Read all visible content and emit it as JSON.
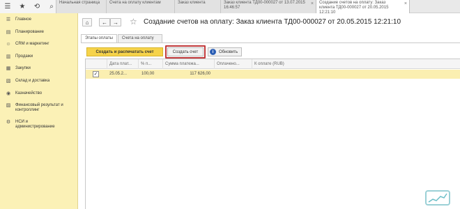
{
  "topbar": {
    "icons": [
      "menu-icon",
      "star-icon",
      "history-icon",
      "search-icon"
    ],
    "tabs": [
      {
        "label": "Начальная страница",
        "active": false
      },
      {
        "label": "Счета на оплату клиентам",
        "active": false
      },
      {
        "label": "Заказ клиента",
        "active": false
      },
      {
        "label": "Заказ клиента ТД00-000027 от 13.07.2015 16:46:57",
        "active": false
      },
      {
        "label": "Создание счетов на оплату: Заказ клиента ТД00-000027 от 20.05.2015 12:21:10",
        "active": true
      }
    ]
  },
  "sidebar": {
    "items": [
      {
        "label": "Главное",
        "icon": "list-icon"
      },
      {
        "label": "Планирование",
        "icon": "planning-icon"
      },
      {
        "label": "CRM и маркетинг",
        "icon": "crm-icon"
      },
      {
        "label": "Продажи",
        "icon": "sales-icon"
      },
      {
        "label": "Закупки",
        "icon": "purchases-icon"
      },
      {
        "label": "Склад и доставка",
        "icon": "warehouse-icon"
      },
      {
        "label": "Казначейство",
        "icon": "treasury-icon"
      },
      {
        "label": "Финансовый результат и контроллинг",
        "icon": "finance-icon"
      },
      {
        "label": "НСИ и администрирование",
        "icon": "settings-icon"
      }
    ]
  },
  "header": {
    "title": "Создание счетов на оплату: Заказ клиента ТД00-000027 от 20.05.2015 12:21:10"
  },
  "form_tabs": [
    {
      "label": "Этапы оплаты",
      "active": true
    },
    {
      "label": "Счета на оплату",
      "active": false
    }
  ],
  "toolbar": {
    "create_and_print_label": "Создать и распечатать счет",
    "create_label": "Создать счет",
    "refresh_label": "Обновить"
  },
  "table": {
    "columns": [
      "Дата плат...",
      "% п...",
      "Сумма платежа...",
      "Оплачено...",
      "К оплате (RUB)"
    ],
    "rows": [
      {
        "checked": true,
        "date": "25.05.2...",
        "percent": "100,00",
        "amount": "117 626,00",
        "paid": "",
        "to_pay": ""
      }
    ]
  },
  "colors": {
    "sidebar_bg": "#fbf1b6",
    "primary_button": "#f6d34a",
    "highlight_frame": "#c0393b",
    "selected_row": "#fbefb1"
  }
}
